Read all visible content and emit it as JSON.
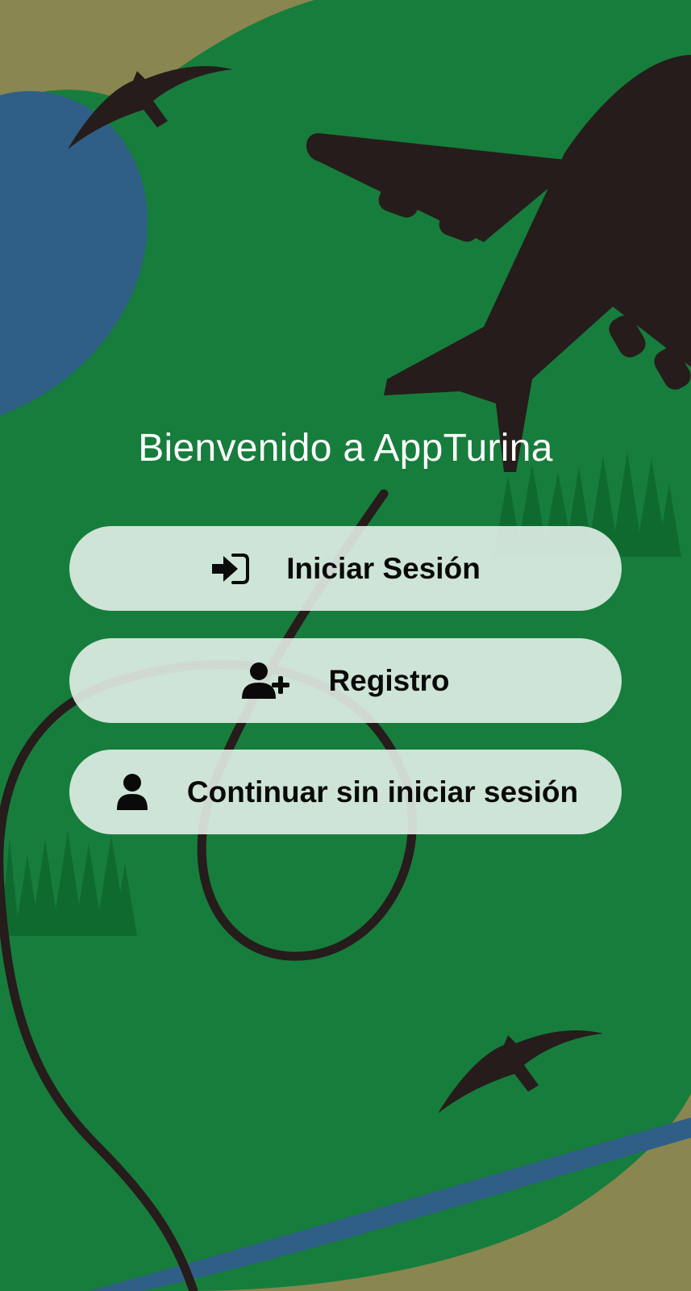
{
  "welcome": {
    "title": "Bienvenido a AppTurina"
  },
  "actions": {
    "login": {
      "label": "Iniciar Sesión",
      "icon": "sign-in-icon"
    },
    "register": {
      "label": "Registro",
      "icon": "user-plus-icon"
    },
    "guest": {
      "label": "Continuar sin iniciar sesión",
      "icon": "user-icon"
    }
  },
  "theme": {
    "land": "#8a8650",
    "grass": "#177d3c",
    "water": "#2f5f86",
    "silhouette": "#261c1b",
    "button_bg": "#dbeae0"
  }
}
